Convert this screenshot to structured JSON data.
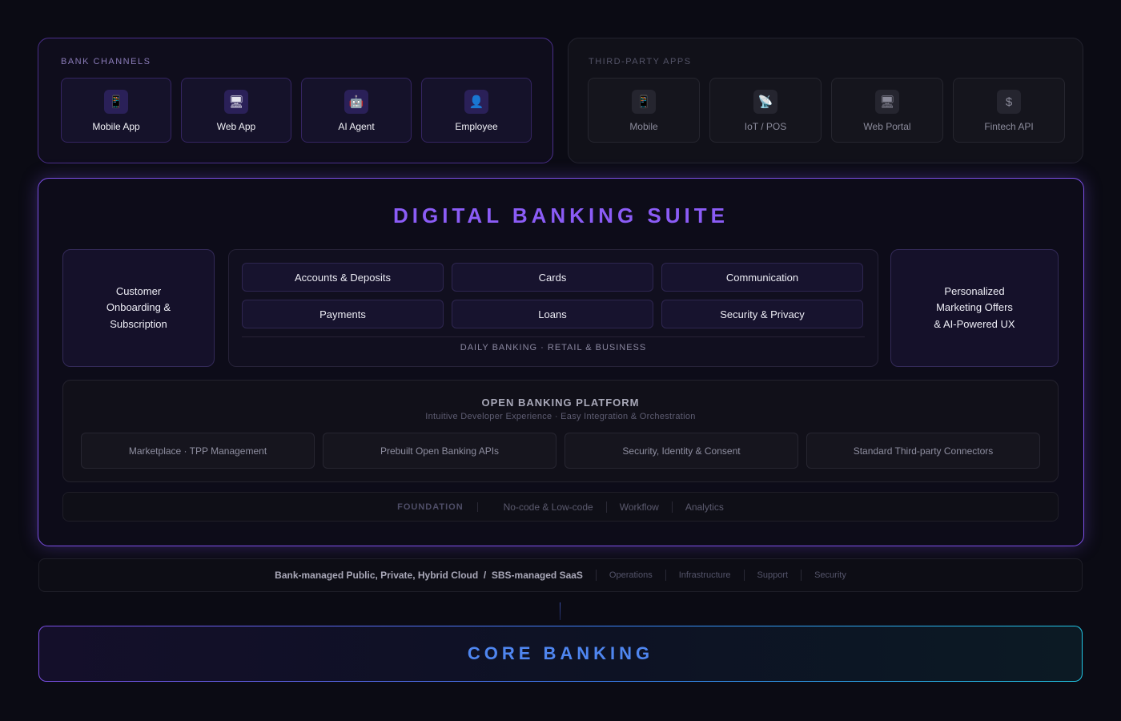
{
  "bank_channels": {
    "label": "BANK CHANNELS",
    "items": [
      {
        "label": "Mobile App",
        "icon": "mobile-phone-icon",
        "glyph": "📱"
      },
      {
        "label": "Web App",
        "icon": "desktop-computer-icon",
        "glyph": "🖥"
      },
      {
        "label": "AI Agent",
        "icon": "robot-icon",
        "glyph": "🤖"
      },
      {
        "label": "Employee",
        "icon": "person-icon",
        "glyph": "👤"
      }
    ]
  },
  "third_party": {
    "label": "THIRD-PARTY APPS",
    "items": [
      {
        "label": "Mobile",
        "icon": "mobile-phone-icon",
        "glyph": "📱"
      },
      {
        "label": "IoT / POS",
        "icon": "satellite-antenna-icon",
        "glyph": "📡"
      },
      {
        "label": "Web Portal",
        "icon": "desktop-computer-icon",
        "glyph": "🖥"
      },
      {
        "label": "Fintech API",
        "icon": "dollar-icon",
        "glyph": "$"
      }
    ]
  },
  "suite": {
    "title": "DIGITAL BANKING SUITE",
    "onboarding": [
      "Customer",
      "Onboarding &",
      "Subscription"
    ],
    "marketing": [
      "Personalized",
      "Marketing Offers",
      "& AI-Powered UX"
    ],
    "daily_banking": {
      "modules": [
        "Accounts & Deposits",
        "Cards",
        "Communication",
        "Payments",
        "Loans",
        "Security & Privacy"
      ],
      "caption": "DAILY BANKING · RETAIL & BUSINESS"
    },
    "open_banking": {
      "title": "OPEN BANKING PLATFORM",
      "subtitle": "Intuitive Developer Experience · Easy Integration & Orchestration",
      "items": [
        "Marketplace · TPP Management",
        "Prebuilt Open Banking APIs",
        "Security, Identity & Consent",
        "Standard Third-party Connectors"
      ]
    },
    "foundation": {
      "label": "FOUNDATION",
      "items": [
        "No-code & Low-code",
        "Workflow",
        "Analytics"
      ]
    }
  },
  "cloud": {
    "primary": "Bank-managed Public, Private, Hybrid Cloud  /  SBS-managed SaaS",
    "items": [
      "Operations",
      "Infrastructure",
      "Support",
      "Security"
    ]
  },
  "core_banking": {
    "title": "CORE BANKING"
  },
  "colors": {
    "accent_purple": "#8b5cf6",
    "accent_blue": "#4f86f0",
    "background": "#0b0b14"
  }
}
